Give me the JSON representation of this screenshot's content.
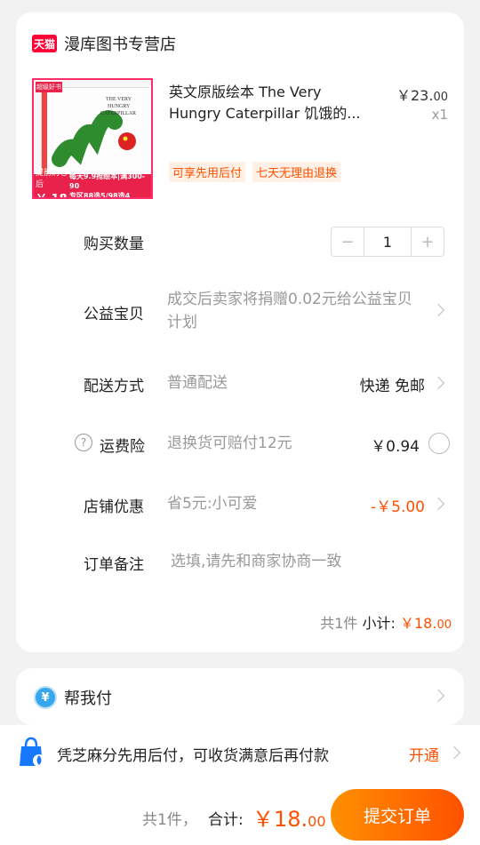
{
  "store": {
    "badge": "天猫",
    "name": "漫库图书专营店"
  },
  "product": {
    "title": "英文原版绘本 The Very Hungry Caterpillar 饥饿的...",
    "price_main": "￥23.",
    "price_decimal": "00",
    "quantity_label": "x1",
    "tags": [
      "可享先用后付",
      "七天无理由退换"
    ],
    "thumb_badge": "超级好书",
    "thumb_promo_line1": "提前购卷后",
    "thumb_promo_price": "￥ 18",
    "thumb_promo_line2": "每天9.9抢绘本|满300-90",
    "thumb_promo_line3": "专区88选5/98选4"
  },
  "rows": {
    "quantity": {
      "label": "购买数量",
      "value": "1",
      "minus": "−",
      "plus": "+"
    },
    "charity": {
      "label": "公益宝贝",
      "desc": "成交后卖家将捐赠0.02元给公益宝贝计划"
    },
    "delivery": {
      "label": "配送方式",
      "method": "普通配送",
      "value": "快递 免邮"
    },
    "insurance": {
      "label": "运费险",
      "desc": "退换货可赔付12元",
      "value": "￥0.94"
    },
    "discount": {
      "label": "店铺优惠",
      "desc": "省5元:小可爱",
      "value": "-￥5.00"
    },
    "note": {
      "label": "订单备注",
      "placeholder": "选填,请先和商家协商一致"
    }
  },
  "subtotal": {
    "count": "共1件",
    "label": "小计:",
    "price_main": "￥18.",
    "price_decimal": "00"
  },
  "pay_for_me": {
    "icon": "¥",
    "label": "帮我付"
  },
  "credit": {
    "text": "凭芝麻分先用后付，可收货满意后再付款",
    "action": "开通"
  },
  "footer": {
    "count": "共1件，",
    "total_label": "合计:",
    "total_main": "￥18.",
    "total_decimal": "00",
    "submit": "提交订单"
  },
  "colors": {
    "accent": "#ff5000",
    "tmall": "#ff0036",
    "pay_blue": "#36a7ee"
  }
}
